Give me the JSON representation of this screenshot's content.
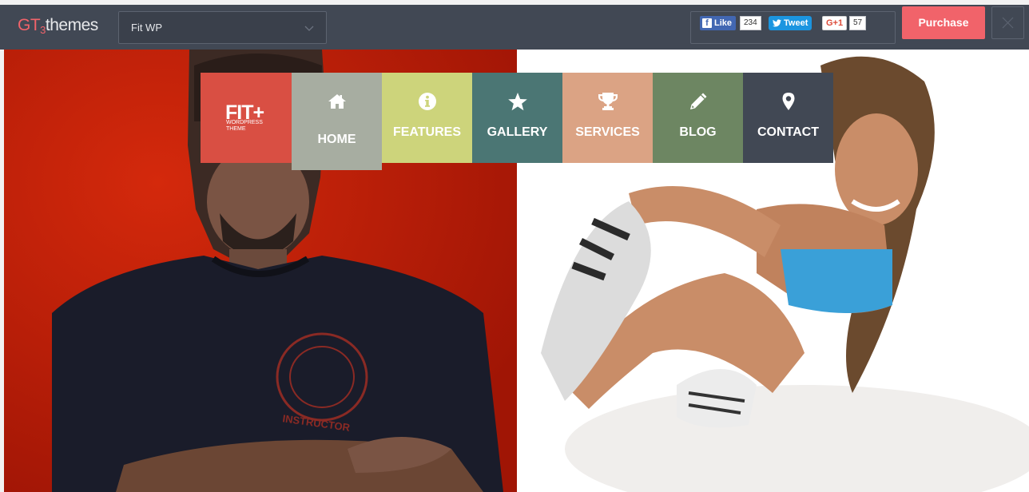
{
  "topbar": {
    "logo_gt": "GT",
    "logo_3": "3",
    "logo_themes": "themes",
    "theme_select_value": "Fit WP",
    "facebook_like_label": "Like",
    "facebook_like_count": "234",
    "tweet_label": "Tweet",
    "gplus_label": "G+1",
    "gplus_count": "57",
    "purchase_label": "Purchase",
    "accent_color": "#f1636a"
  },
  "brand": {
    "title": "FIT+",
    "subtitle_line1": "WORDPRESS",
    "subtitle_line2": "THEME",
    "color": "#d94f43"
  },
  "menu": {
    "items": [
      {
        "label": "HOME",
        "icon": "home-icon",
        "color": "#a7ada1",
        "active": true
      },
      {
        "label": "FEATURES",
        "icon": "info-circle-icon",
        "color": "#cdd47b",
        "active": false
      },
      {
        "label": "GALLERY",
        "icon": "star-icon",
        "color": "#4b7674",
        "active": false
      },
      {
        "label": "SERVICES",
        "icon": "trophy-icon",
        "color": "#dba384",
        "active": false
      },
      {
        "label": "BLOG",
        "icon": "pencil-icon",
        "color": "#6d8662",
        "active": false
      },
      {
        "label": "CONTACT",
        "icon": "map-marker-icon",
        "color": "#414854",
        "active": false
      }
    ]
  },
  "hero": {
    "left_shirt_text": "INSTRUCTOR"
  }
}
